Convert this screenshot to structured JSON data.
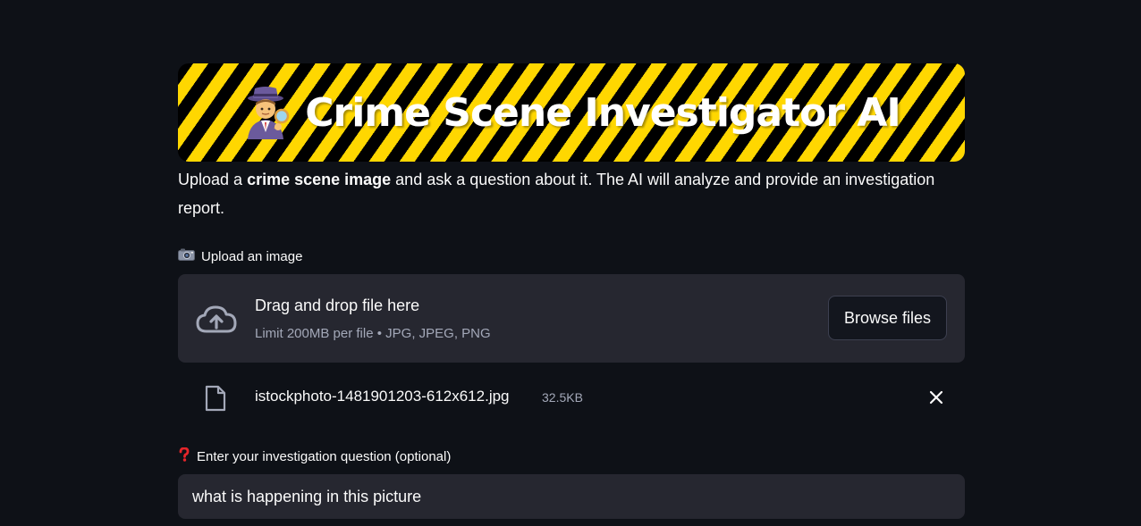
{
  "header": {
    "title": "Crime Scene Investigator AI",
    "icon": "detective-emoji"
  },
  "intro": {
    "text_before": "Upload a ",
    "bold": "crime scene image",
    "text_after": " and ask a question about it. The AI will analyze and provide an investigation report."
  },
  "upload": {
    "label_icon": "camera-emoji",
    "label": "Upload an image",
    "drop_title": "Drag and drop file here",
    "drop_limit": "Limit 200MB per file • JPG, JPEG, PNG",
    "browse_label": "Browse files",
    "icon": "cloud-upload-icon"
  },
  "uploaded_file": {
    "name": "istockphoto-1481901203-612x612.jpg",
    "size": "32.5KB",
    "icon": "file-icon"
  },
  "question": {
    "label_icon": "question-mark-emoji",
    "label": "Enter your investigation question (optional)",
    "value": "what is happening in this picture"
  },
  "colors": {
    "background": "#0e1117",
    "widget_bg": "#262730",
    "stripe_yellow": "#ffd700",
    "stripe_black": "#000000",
    "text": "#fafafa",
    "muted_text": "#a3a8b8"
  }
}
